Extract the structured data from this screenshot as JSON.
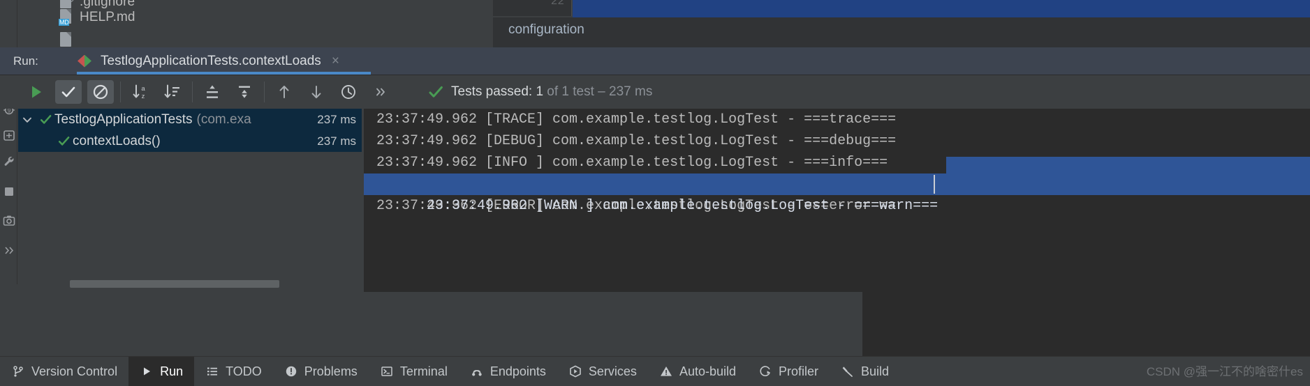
{
  "project_files": [
    {
      "name": ".gitignore",
      "icon": "gitignore-file-icon"
    },
    {
      "name": "HELP.md",
      "icon": "markdown-file-icon",
      "badge": "MD"
    }
  ],
  "editor": {
    "line_number": "22",
    "visible_text": "configuration",
    "selection_color": "#214283"
  },
  "run_window": {
    "label": "Run:",
    "tab": {
      "title": "TestlogApplicationTests.contextLoads",
      "close_icon": "×",
      "run_config_icon": "junit-run-icon"
    },
    "toolbar": {
      "rerun_label": "Rerun",
      "buttons": [
        {
          "name": "rerun-button",
          "icon": "play-icon",
          "pressed": false
        },
        {
          "name": "show-passed-toggle",
          "icon": "check-icon",
          "pressed": true
        },
        {
          "name": "show-ignored-toggle",
          "icon": "no-entry-icon",
          "pressed": true
        },
        {
          "name": "sort-alphabetically-button",
          "icon": "sort-alpha-icon",
          "pressed": false
        },
        {
          "name": "sort-by-duration-button",
          "icon": "sort-duration-icon",
          "pressed": false
        },
        {
          "name": "expand-all-button",
          "icon": "expand-all-icon",
          "pressed": false
        },
        {
          "name": "collapse-all-button",
          "icon": "collapse-all-icon",
          "pressed": false
        },
        {
          "name": "previous-failed-button",
          "icon": "arrow-up-icon",
          "pressed": false
        },
        {
          "name": "next-failed-button",
          "icon": "arrow-down-icon",
          "pressed": false
        },
        {
          "name": "test-history-button",
          "icon": "clock-icon",
          "pressed": false
        },
        {
          "name": "more-options-button",
          "icon": "chevron-double-right-icon",
          "pressed": false
        }
      ]
    },
    "status": {
      "icon": "green-check-icon",
      "prefix": "Tests passed: ",
      "count": "1",
      "suffix": " of 1 test – 237 ms"
    },
    "left_rail": [
      {
        "name": "debug-button",
        "icon": "debug-icon"
      },
      {
        "name": "coverage-button",
        "icon": "coverage-icon"
      },
      {
        "name": "settings-button",
        "icon": "wrench-icon"
      },
      {
        "name": "stop-button",
        "icon": "stop-square-icon"
      },
      {
        "name": "screenshot-button",
        "icon": "camera-icon"
      },
      {
        "name": "expand-rail-button",
        "icon": "chevron-double-right-icon"
      }
    ]
  },
  "test_tree": {
    "rows": [
      {
        "name": "TestlogApplicationTests",
        "package": "(com.exa",
        "duration": "237 ms",
        "status_icon": "green-check-icon",
        "expander": "chevron-down-icon",
        "indent": 0,
        "selected": true
      },
      {
        "name": "contextLoads()",
        "package": "",
        "duration": "237 ms",
        "status_icon": "green-check-icon",
        "expander": "",
        "indent": 1,
        "selected": true
      }
    ]
  },
  "console": {
    "lines": [
      {
        "text": "23:37:49.962 [TRACE] com.example.testlog.LogTest - ===trace===",
        "selected": false
      },
      {
        "text": "23:37:49.962 [DEBUG] com.example.testlog.LogTest - ===debug===",
        "selected": false
      },
      {
        "text": "23:37:49.962 [INFO ] com.example.testlog.LogTest - ===info===",
        "selected": false
      },
      {
        "text": "23:37:49.962 [WARN ] com.example.testlog.LogTest - ===warn===",
        "selected": true
      },
      {
        "text": "23:37:49.962 [ERROR] com.example.testlog.LogTest - ===error===",
        "selected": false
      }
    ],
    "selection_color": "#2f5597"
  },
  "status_bar": {
    "items": [
      {
        "label": "Version Control",
        "icon": "branch-icon",
        "active": false
      },
      {
        "label": "Run",
        "icon": "play-icon",
        "active": true
      },
      {
        "label": "TODO",
        "icon": "list-icon",
        "active": false
      },
      {
        "label": "Problems",
        "icon": "exclamation-circle-icon",
        "active": false
      },
      {
        "label": "Terminal",
        "icon": "terminal-icon",
        "active": false
      },
      {
        "label": "Endpoints",
        "icon": "endpoints-icon",
        "active": false
      },
      {
        "label": "Services",
        "icon": "services-icon",
        "active": false
      },
      {
        "label": "Auto-build",
        "icon": "warning-triangle-icon",
        "active": false
      },
      {
        "label": "Profiler",
        "icon": "profiler-icon",
        "active": false
      },
      {
        "label": "Build",
        "icon": "hammer-icon",
        "active": false
      }
    ]
  },
  "watermark": {
    "text": "CSDN @强一江不的啥密什es"
  },
  "colors": {
    "accent": "#4a88c7",
    "pass_green": "#499c54",
    "selection_blue": "#2f5597",
    "tree_selection": "#0d293e",
    "console_bg": "#2b2b2b",
    "panel_bg": "#3c3f41"
  }
}
